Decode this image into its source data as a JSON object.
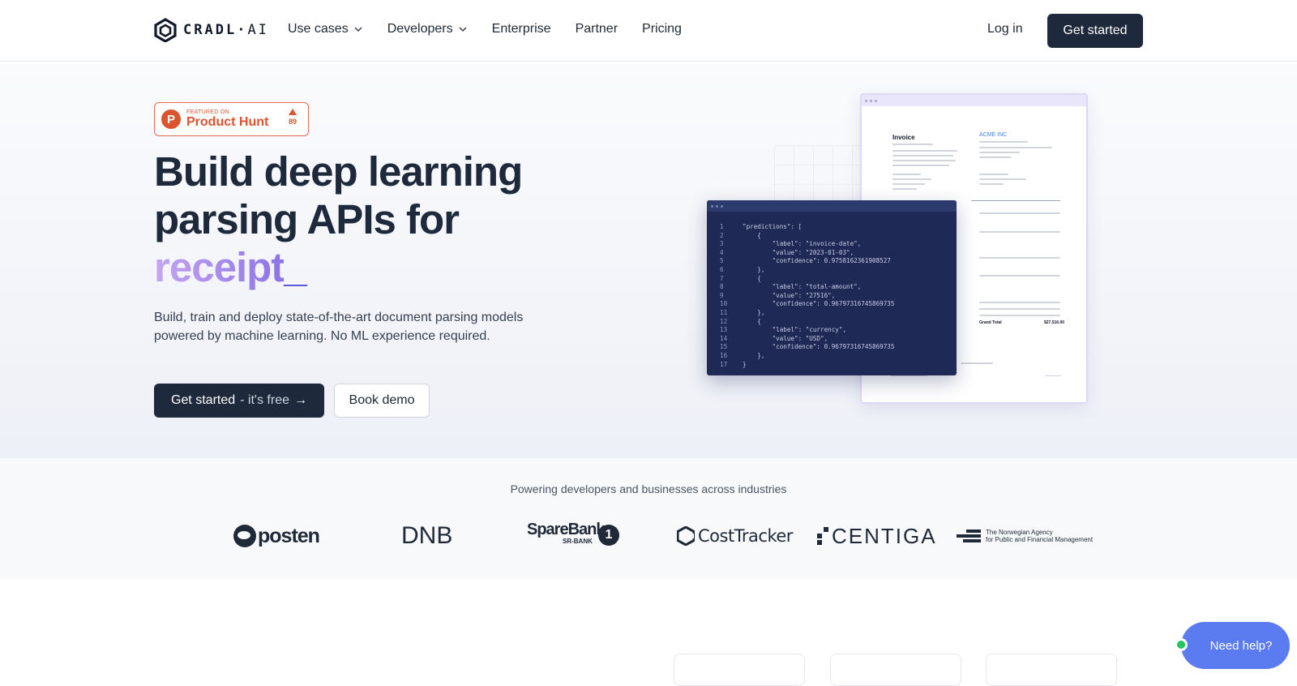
{
  "nav": {
    "logo_text": "CRADL",
    "logo_suffix": "AI",
    "links": [
      {
        "label": "Use cases",
        "dropdown": true
      },
      {
        "label": "Developers",
        "dropdown": true
      },
      {
        "label": "Enterprise",
        "dropdown": false
      },
      {
        "label": "Partner",
        "dropdown": false
      },
      {
        "label": "Pricing",
        "dropdown": false
      }
    ],
    "login_label": "Log in",
    "cta_label": "Get started"
  },
  "hero": {
    "badge": {
      "small": "FEATURED ON",
      "name": "Product Hunt",
      "votes": "89",
      "letter": "P"
    },
    "heading_line1": "Build deep learning",
    "heading_line2": "parsing APIs for",
    "typed_word": "receipt",
    "cursor": "_",
    "subtitle": "Build, train and deploy state-of-the-art document parsing models powered by machine learning. No ML experience required.",
    "primary_btn": {
      "label": "Get started",
      "suffix": "- it's free",
      "arrow": "→"
    },
    "secondary_btn": "Book demo"
  },
  "illustration": {
    "invoice_title": "Invoice",
    "invoice_company": "ACME INC",
    "grand_total_label": "Grand Total",
    "grand_total_value": "$27,516.00",
    "code_lines": [
      "\"predictions\": [",
      "    {",
      "        \"label\": \"invoice-date\",",
      "        \"value\": \"2023-01-03\",",
      "        \"confidence\": 0.9758162361908527",
      "    },",
      "    {",
      "        \"label\": \"total-amount\",",
      "        \"value\": \"27516\",",
      "        \"confidence\": 0.96797316745869735",
      "    },",
      "    {",
      "        \"label\": \"currency\",",
      "        \"value\": \"USD\",",
      "        \"confidence\": 0.96797316745869735",
      "    },",
      "}"
    ]
  },
  "logos": {
    "heading": "Powering developers and businesses across industries",
    "posten": "posten",
    "dnb": "DNB",
    "sparebank": "SpareBank",
    "sparebank_sub": "SR-BANK",
    "sparebank_num": "1",
    "costtracker": "CostTracker",
    "centiga": "CENTIGA",
    "norwegian_line1": "The Norwegian Agency",
    "norwegian_line2": "for Public and Financial Management"
  },
  "help": {
    "label": "Need help?"
  },
  "colors": {
    "primary": "#1e293b",
    "accent_gradient_start": "#c4a5f0",
    "accent_gradient_end": "#8b74e8",
    "producthunt": "#da552f",
    "help_button": "#5b7cf0",
    "online": "#22c55e"
  }
}
